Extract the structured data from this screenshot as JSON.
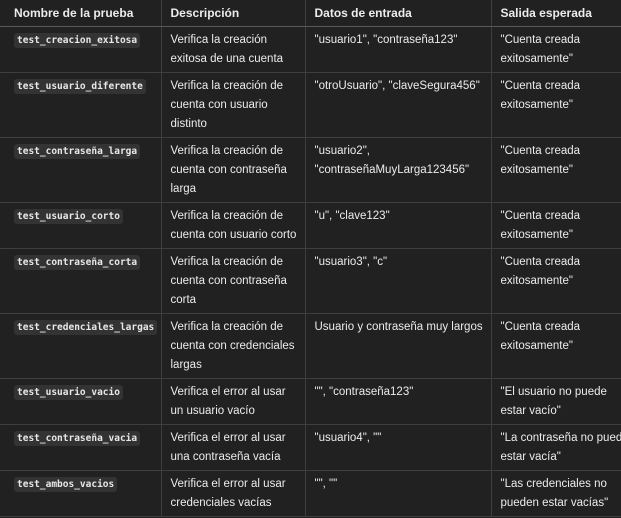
{
  "table": {
    "headers": [
      "Nombre de la prueba",
      "Descripción",
      "Datos de entrada",
      "Salida esperada"
    ],
    "rows": [
      {
        "name": "test_creacion_exitosa",
        "description": "Verifica la creación exitosa de una cuenta",
        "input": "\"usuario1\", \"contraseña123\"",
        "output": "\"Cuenta creada exitosamente\""
      },
      {
        "name": "test_usuario_diferente",
        "description": "Verifica la creación de cuenta con usuario distinto",
        "input": "\"otroUsuario\", \"claveSegura456\"",
        "output": "\"Cuenta creada exitosamente\""
      },
      {
        "name": "test_contraseña_larga",
        "description": "Verifica la creación de cuenta con contraseña larga",
        "input": "\"usuario2\", \"contraseñaMuyLarga123456\"",
        "output": "\"Cuenta creada exitosamente\""
      },
      {
        "name": "test_usuario_corto",
        "description": "Verifica la creación de cuenta con usuario corto",
        "input": "\"u\", \"clave123\"",
        "output": "\"Cuenta creada exitosamente\""
      },
      {
        "name": "test_contraseña_corta",
        "description": "Verifica la creación de cuenta con contraseña corta",
        "input": "\"usuario3\", \"c\"",
        "output": "\"Cuenta creada exitosamente\""
      },
      {
        "name": "test_credenciales_largas",
        "description": "Verifica la creación de cuenta con credenciales largas",
        "input": "Usuario y contraseña muy largos",
        "output": "\"Cuenta creada exitosamente\""
      },
      {
        "name": "test_usuario_vacio",
        "description": "Verifica el error al usar un usuario vacío",
        "input": "\"\", \"contraseña123\"",
        "output": "\"El usuario no puede estar vacío\""
      },
      {
        "name": "test_contraseña_vacia",
        "description": "Verifica el error al usar una contraseña vacía",
        "input": "\"usuario4\", \"\"",
        "output": "\"La contraseña no puede estar vacía\""
      },
      {
        "name": "test_ambos_vacios",
        "description": "Verifica el error al usar credenciales vacías",
        "input": "\"\", \"\"",
        "output": "\"Las credenciales no pueden estar vacías\""
      }
    ]
  }
}
